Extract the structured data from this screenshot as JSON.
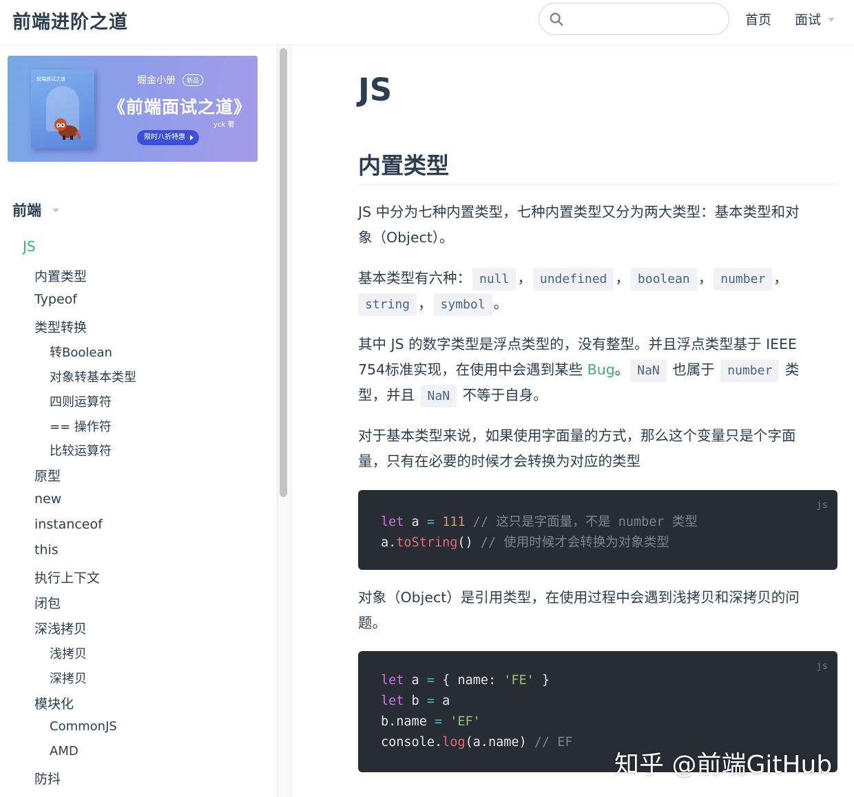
{
  "header": {
    "site_name": "前端进阶之道",
    "search": {
      "value": "",
      "placeholder": ""
    },
    "nav": {
      "home": "首页",
      "interview": "面试"
    }
  },
  "sidebar": {
    "banner": {
      "book_title": "前端面试之道",
      "brand": "掘金小册",
      "badge": "新品",
      "title": "《前端面试之道》",
      "author": "yck 著",
      "cta": "限时八折特惠"
    },
    "group": "前端",
    "items": [
      {
        "label": "JS",
        "level": 1,
        "active": true
      },
      {
        "label": "内置类型",
        "level": 2
      },
      {
        "label": "Typeof",
        "level": 2
      },
      {
        "label": "类型转换",
        "level": 2
      },
      {
        "label": "转Boolean",
        "level": 3
      },
      {
        "label": "对象转基本类型",
        "level": 3
      },
      {
        "label": "四则运算符",
        "level": 3
      },
      {
        "label": "== 操作符",
        "level": 3
      },
      {
        "label": "比较运算符",
        "level": 3
      },
      {
        "label": "原型",
        "level": 2
      },
      {
        "label": "new",
        "level": 2
      },
      {
        "label": "instanceof",
        "level": 2
      },
      {
        "label": "this",
        "level": 2
      },
      {
        "label": "执行上下文",
        "level": 2
      },
      {
        "label": "闭包",
        "level": 2
      },
      {
        "label": "深浅拷贝",
        "level": 2
      },
      {
        "label": "浅拷贝",
        "level": 3
      },
      {
        "label": "深拷贝",
        "level": 3
      },
      {
        "label": "模块化",
        "level": 2
      },
      {
        "label": "CommonJS",
        "level": 3
      },
      {
        "label": "AMD",
        "level": 3
      },
      {
        "label": "防抖",
        "level": 2
      }
    ]
  },
  "content": {
    "title": "JS",
    "section_title": "内置类型",
    "p1": {
      "line1": "JS 中分为七种内置类型，七种内置类型又分为两大类型：基本类型和对",
      "line2": "象（Object）。"
    },
    "p2": {
      "lead": "基本类型有六种：",
      "types": [
        "null",
        "undefined",
        "boolean",
        "number",
        "string",
        "symbol"
      ],
      "sep": "，",
      "end": "。"
    },
    "p3": {
      "line1": "其中 JS 的数字类型是浮点类型的，没有整型。并且浮点类型基于 IEEE",
      "line2_a": "754标准实现，在使用中会遇到某些 ",
      "bug_link": "Bug",
      "line2_b": "。",
      "nan": "NaN",
      "line2_c": " 也属于 ",
      "number": "number",
      "line2_d": " 类",
      "line3_a": "型，并且 ",
      "line3_b": " 不等于自身。"
    },
    "p4": {
      "line1": "对于基本类型来说，如果使用字面量的方式，那么这个变量只是个字面",
      "line2": "量，只有在必要的时候才会转换为对应的类型"
    },
    "code1": {
      "lang": "js",
      "l1": {
        "kw": "let",
        "name": " a ",
        "op": "=",
        "num": " 111",
        "comment": " // 这只是字面量，不是 number 类型"
      },
      "l2": {
        "obj": "a.",
        "fn": "toString",
        "paren": "()",
        "comment": " // 使用时候才会转换为对象类型"
      }
    },
    "p5": {
      "line1": "对象（Object）是引用类型，在使用过程中会遇到浅拷贝和深拷贝的问",
      "line2": "题。"
    },
    "code2": {
      "lang": "js",
      "l1": {
        "kw": "let",
        "name": " a ",
        "op": "=",
        "rest_a": " { name: ",
        "str": "'FE'",
        "rest_b": " }"
      },
      "l2": {
        "kw": "let",
        "name": " b ",
        "op": "=",
        "rest": " a"
      },
      "l3": {
        "obj": "b.name ",
        "op": "=",
        "str": " 'EF'"
      },
      "l4": {
        "obj": "console.",
        "fn": "log",
        "rest": "(a.name)",
        "comment": " // EF"
      }
    }
  },
  "watermark": "知乎 @前端GitHub"
}
